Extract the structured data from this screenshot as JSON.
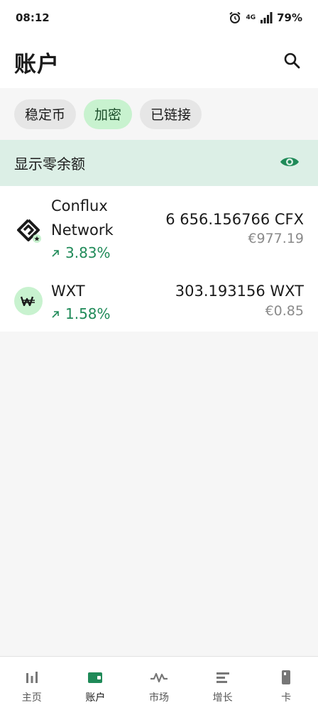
{
  "status_bar": {
    "time": "08:12",
    "network": "4G",
    "battery": "79%"
  },
  "header": {
    "title": "账户",
    "search_icon": "search-icon"
  },
  "filters": [
    {
      "label": "稳定币",
      "active": false
    },
    {
      "label": "加密",
      "active": true
    },
    {
      "label": "已链接",
      "active": false
    }
  ],
  "zero_balance": {
    "label": "显示零余额",
    "icon": "eye-icon"
  },
  "assets": [
    {
      "name_line1": "Conflux",
      "name_line2": "Network",
      "change": "3.83%",
      "amount": "6 656.156766 CFX",
      "fiat": "€977.19"
    },
    {
      "name_line1": "WXT",
      "change": "1.58%",
      "amount": "303.193156 WXT",
      "fiat": "€0.85",
      "icon_text": "W"
    }
  ],
  "nav": [
    {
      "label": "主页",
      "icon": "home-chart-icon"
    },
    {
      "label": "账户",
      "icon": "wallet-icon",
      "active": true
    },
    {
      "label": "市场",
      "icon": "market-pulse-icon"
    },
    {
      "label": "增长",
      "icon": "growth-icon"
    },
    {
      "label": "卡",
      "icon": "card-icon"
    }
  ],
  "colors": {
    "accent_green": "#1f8a58",
    "active_chip_bg": "#c8f2cf",
    "zero_row_bg": "#dcefe6"
  }
}
